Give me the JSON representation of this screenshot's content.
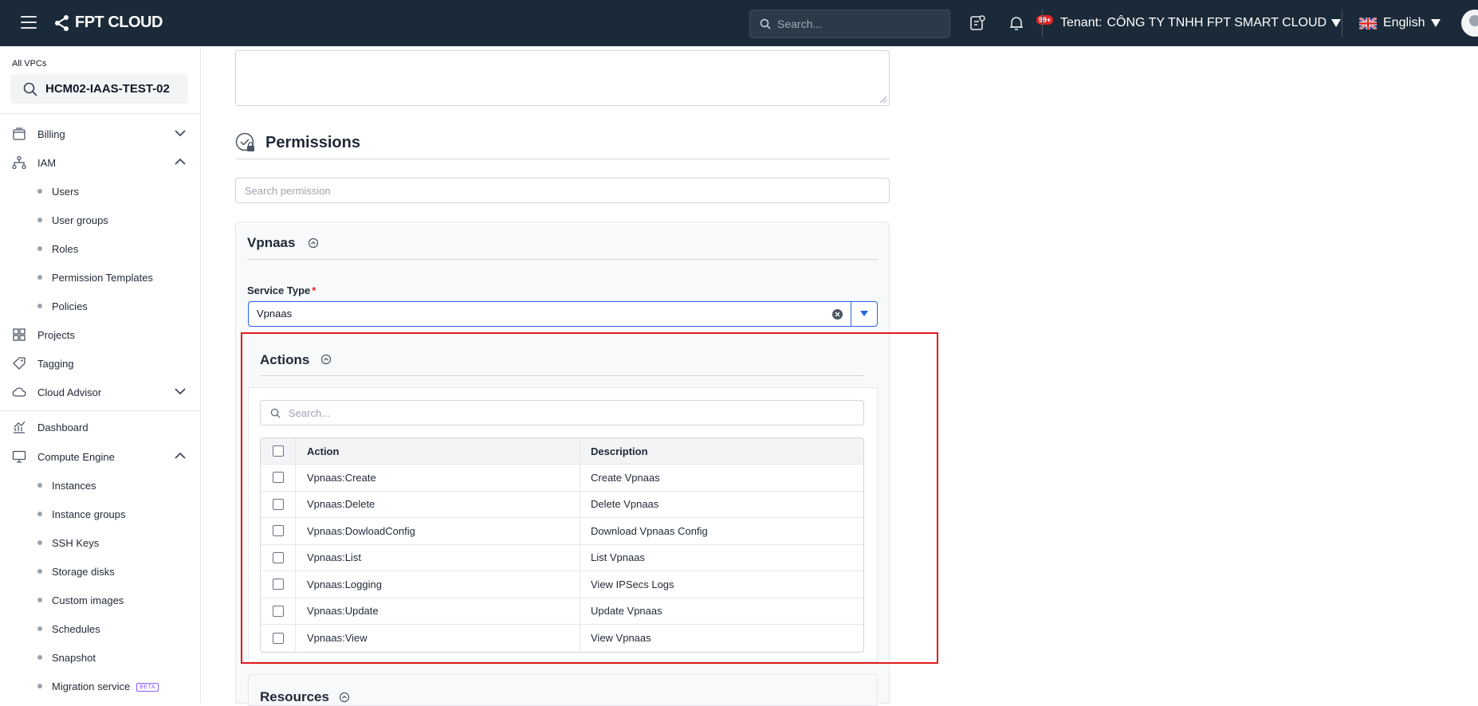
{
  "topbar": {
    "brand": "FPT CLOUD",
    "search_placeholder": "Search...",
    "notification_count": "99+",
    "tenant_label": "Tenant:",
    "tenant_name": "CÔNG TY TNHH FPT SMART CLOUD",
    "language": "English"
  },
  "sidebar": {
    "vpc_label": "All VPCs",
    "vpc_name": "HCM02-IAAS-TEST-02",
    "billing": "Billing",
    "iam": "IAM",
    "iam_items": [
      "Users",
      "User groups",
      "Roles",
      "Permission Templates",
      "Policies"
    ],
    "projects": "Projects",
    "tagging": "Tagging",
    "cloud_advisor": "Cloud Advisor",
    "dashboard": "Dashboard",
    "compute_engine": "Compute Engine",
    "compute_items": [
      "Instances",
      "Instance groups",
      "SSH Keys",
      "Storage disks",
      "Custom images",
      "Schedules",
      "Snapshot",
      "Migration service"
    ],
    "beta_badge": "BETA"
  },
  "main": {
    "permissions_title": "Permissions",
    "permission_search_placeholder": "Search permission",
    "service_group": "Vpnaas",
    "service_type_label": "Service Type",
    "service_type_required": "*",
    "service_type_value": "Vpnaas",
    "actions_title": "Actions",
    "actions_search_placeholder": "Search...",
    "table": {
      "headers": {
        "action": "Action",
        "description": "Description"
      },
      "rows": [
        {
          "action": "Vpnaas:Create",
          "description": "Create Vpnaas"
        },
        {
          "action": "Vpnaas:Delete",
          "description": "Delete Vpnaas"
        },
        {
          "action": "Vpnaas:DowloadConfig",
          "description": "Download Vpnaas Config"
        },
        {
          "action": "Vpnaas:List",
          "description": "List Vpnaas"
        },
        {
          "action": "Vpnaas:Logging",
          "description": "View IPSecs Logs"
        },
        {
          "action": "Vpnaas:Update",
          "description": "Update Vpnaas"
        },
        {
          "action": "Vpnaas:View",
          "description": "View Vpnaas"
        }
      ]
    },
    "resources_title": "Resources"
  },
  "colors": {
    "topbar_bg": "#1b2a38",
    "accent_blue": "#2563eb",
    "highlight_red": "#e21a1a",
    "required_red": "#dc2626"
  },
  "icons": [
    "hamburger-icon",
    "fpt-logo-icon",
    "search-icon",
    "task-icon",
    "bell-icon",
    "uk-flag-icon",
    "caret-down-icon",
    "avatar",
    "billing-icon",
    "iam-icon",
    "projects-icon",
    "tag-icon",
    "cloud-advisor-icon",
    "dashboard-icon",
    "compute-icon",
    "chevron-down-icon",
    "chevron-up-icon",
    "permission-lock-icon",
    "collapse-icon",
    "clear-icon"
  ]
}
